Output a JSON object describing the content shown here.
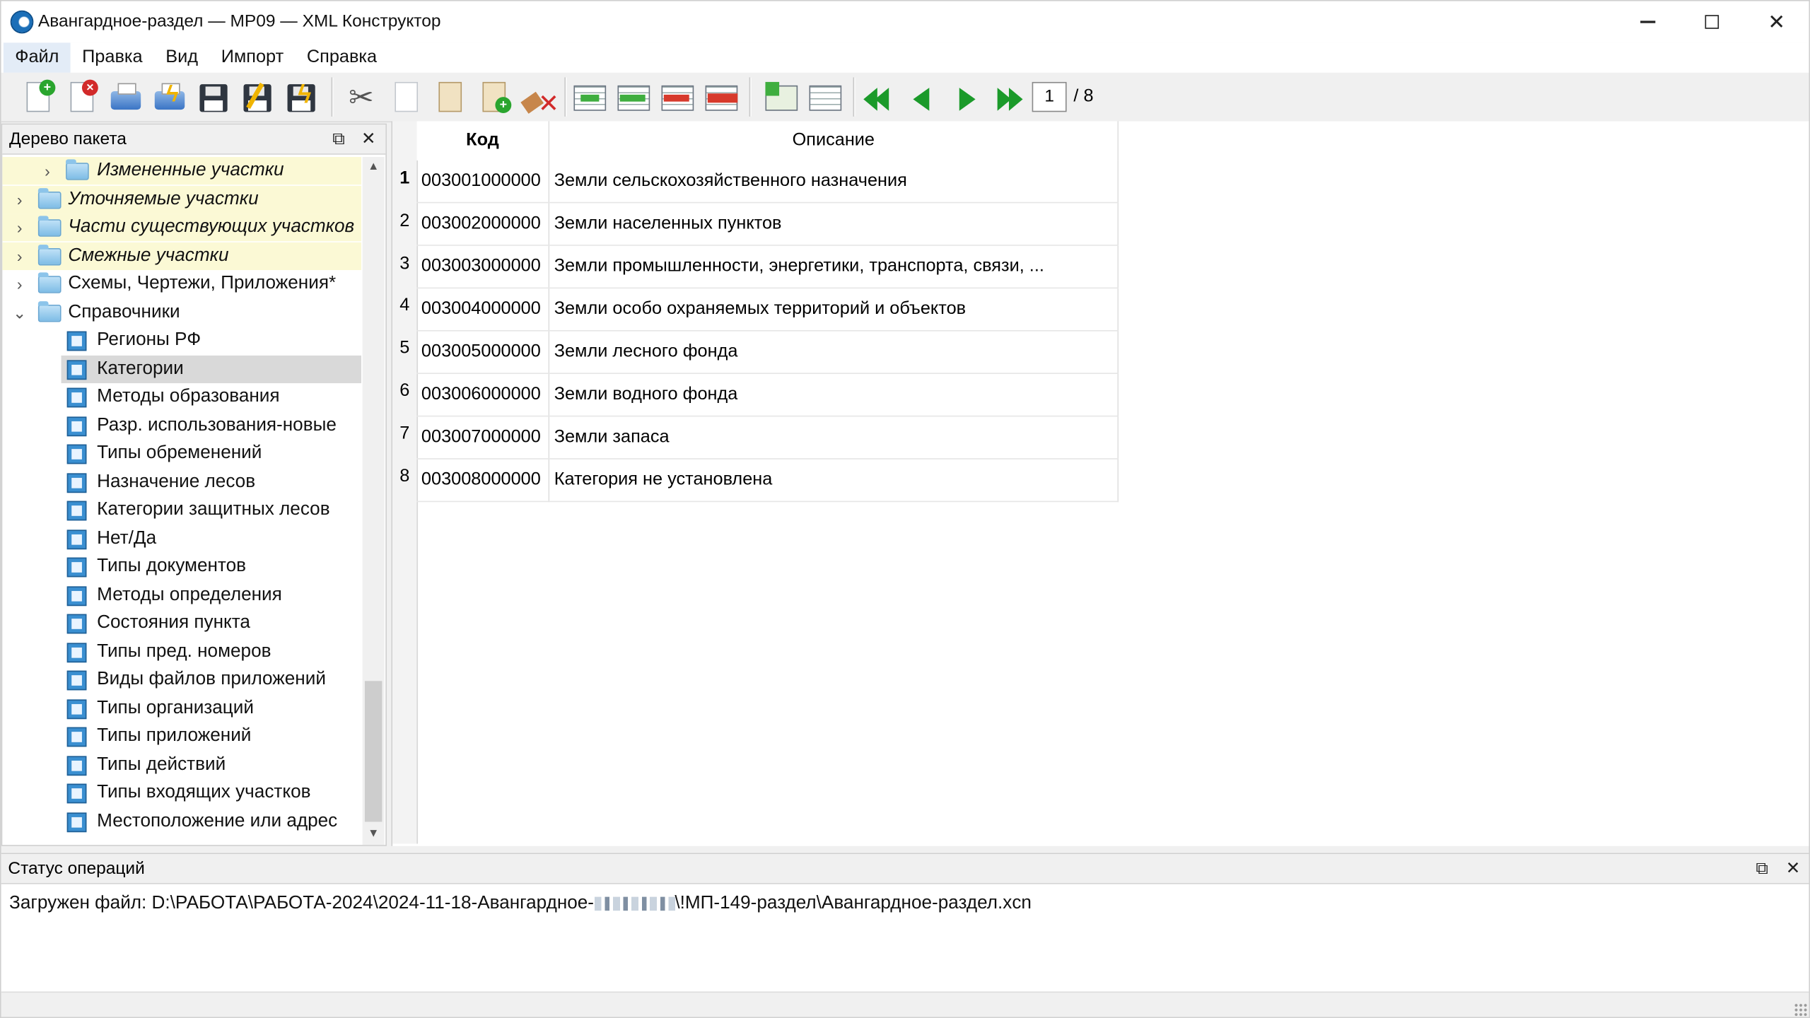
{
  "window": {
    "title": "Авангардное-раздел — МР09 — XML Конструктор",
    "controls": [
      "minimize",
      "maximize",
      "close"
    ]
  },
  "menu": [
    "Файл",
    "Правка",
    "Вид",
    "Импорт",
    "Справка"
  ],
  "toolbar": {
    "icons": [
      "new-document-icon",
      "delete-document-icon",
      "print-icon",
      "print-quick-icon",
      "save-icon",
      "save-as-icon",
      "save-validate-icon",
      "cut-icon",
      "copy-icon",
      "paste-icon",
      "paste-new-icon",
      "clear-icon",
      "add-row-icon",
      "insert-row-icon",
      "delete-row-icon",
      "remove-row-icon",
      "import-table-icon",
      "table-view-icon",
      "first-page-icon",
      "prev-page-icon",
      "next-page-icon",
      "last-page-icon"
    ],
    "page_current": "1",
    "page_total": "/ 8"
  },
  "tree": {
    "title": "Дерево пакета",
    "items": [
      {
        "label": "Измененные участки",
        "level": 1,
        "expander": "›",
        "italic": true,
        "highlight": true,
        "icon": "folder-icon"
      },
      {
        "label": "Уточняемые участки",
        "level": 0,
        "expander": "›",
        "italic": true,
        "highlight": true,
        "icon": "folder-icon"
      },
      {
        "label": "Части существующих участков",
        "level": 0,
        "expander": "›",
        "italic": true,
        "highlight": true,
        "icon": "folder-icon"
      },
      {
        "label": "Смежные участки",
        "level": 0,
        "expander": "›",
        "italic": true,
        "highlight": true,
        "icon": "folder-icon"
      },
      {
        "label": "Схемы, Чертежи, Приложения*",
        "level": 0,
        "expander": "›",
        "italic": false,
        "highlight": false,
        "icon": "folder-icon"
      },
      {
        "label": "Справочники",
        "level": 0,
        "expander": "⌄",
        "italic": false,
        "highlight": false,
        "icon": "folder-icon"
      },
      {
        "label": "Регионы РФ",
        "level": 2,
        "icon": "reference-table-icon"
      },
      {
        "label": "Категории",
        "level": 2,
        "icon": "reference-table-icon",
        "selected": true
      },
      {
        "label": "Методы образования",
        "level": 2,
        "icon": "reference-table-icon"
      },
      {
        "label": "Разр. использования-новые",
        "level": 2,
        "icon": "reference-table-icon"
      },
      {
        "label": "Типы обременений",
        "level": 2,
        "icon": "reference-table-icon"
      },
      {
        "label": "Назначение лесов",
        "level": 2,
        "icon": "reference-table-icon"
      },
      {
        "label": "Категории защитных лесов",
        "level": 2,
        "icon": "reference-table-icon"
      },
      {
        "label": "Нет/Да",
        "level": 2,
        "icon": "reference-table-icon"
      },
      {
        "label": "Типы документов",
        "level": 2,
        "icon": "reference-table-icon"
      },
      {
        "label": "Методы определения",
        "level": 2,
        "icon": "reference-table-icon"
      },
      {
        "label": "Состояния пункта",
        "level": 2,
        "icon": "reference-table-icon"
      },
      {
        "label": "Типы пред. номеров",
        "level": 2,
        "icon": "reference-table-icon"
      },
      {
        "label": "Виды файлов приложений",
        "level": 2,
        "icon": "reference-table-icon"
      },
      {
        "label": "Типы организаций",
        "level": 2,
        "icon": "reference-table-icon"
      },
      {
        "label": "Типы приложений",
        "level": 2,
        "icon": "reference-table-icon"
      },
      {
        "label": "Типы действий",
        "level": 2,
        "icon": "reference-table-icon"
      },
      {
        "label": "Типы входящих участков",
        "level": 2,
        "icon": "reference-table-icon"
      },
      {
        "label": "Местоположение или адрес",
        "level": 2,
        "icon": "reference-table-icon"
      }
    ]
  },
  "grid": {
    "columns": [
      "Код",
      "Описание"
    ],
    "rows": [
      {
        "num": "1",
        "code": "003001000000",
        "desc": "Земли сельскохозяйственного назначения"
      },
      {
        "num": "2",
        "code": "003002000000",
        "desc": "Земли населенных пунктов"
      },
      {
        "num": "3",
        "code": "003003000000",
        "desc": "Земли промышленности, энергетики, транспорта, связи, ..."
      },
      {
        "num": "4",
        "code": "003004000000",
        "desc": "Земли особо охраняемых территорий и объектов"
      },
      {
        "num": "5",
        "code": "003005000000",
        "desc": "Земли лесного фонда"
      },
      {
        "num": "6",
        "code": "003006000000",
        "desc": "Земли водного фонда"
      },
      {
        "num": "7",
        "code": "003007000000",
        "desc": "Земли запаса"
      },
      {
        "num": "8",
        "code": "003008000000",
        "desc": "Категория не установлена"
      }
    ]
  },
  "status": {
    "title": "Статус операций",
    "message_prefix": "Загружен файл: D:\\РАБОТА\\РАБОТА-2024\\2024-11-18-Авангардное-",
    "message_suffix": "\\!МП-149-раздел\\Авангардное-раздел.xcn"
  }
}
